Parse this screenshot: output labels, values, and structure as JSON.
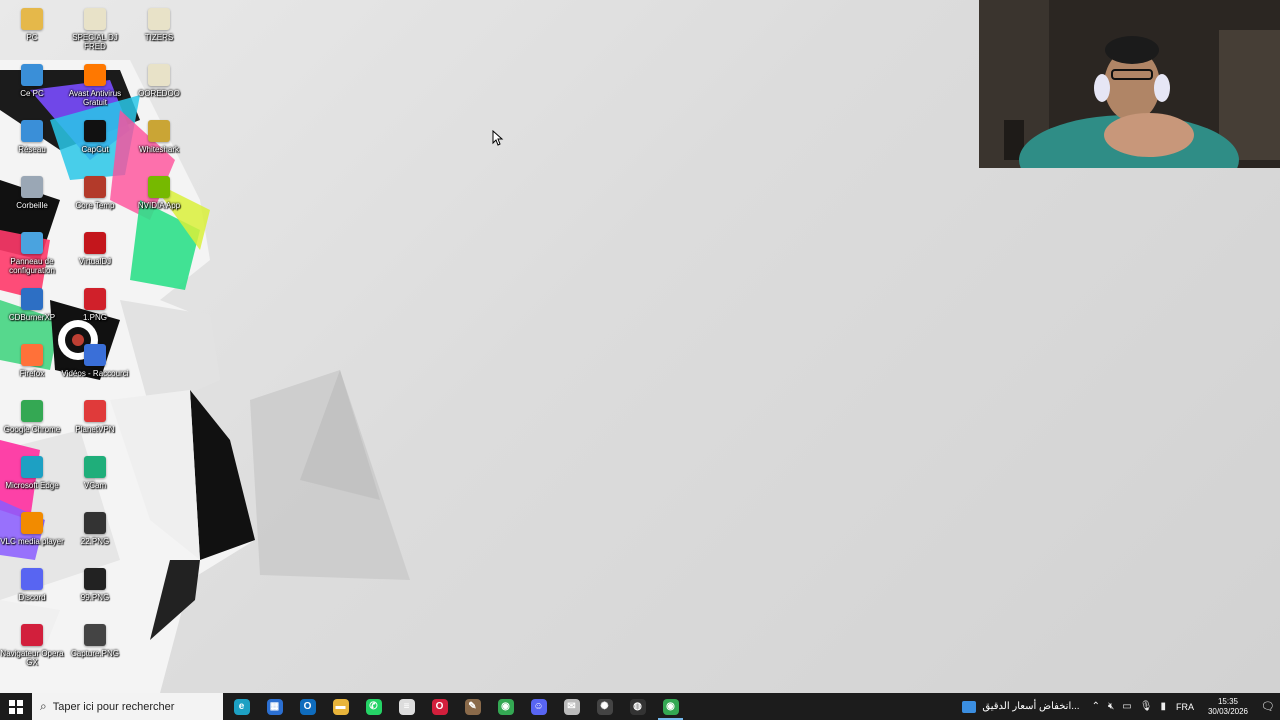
{
  "desktop": {
    "column1": [
      {
        "label": "PC",
        "icon": "user-folder-icon",
        "color": "#e5b84a"
      },
      {
        "label": "Ce PC",
        "icon": "computer-icon",
        "color": "#3a8fd8"
      },
      {
        "label": "Réseau",
        "icon": "network-icon",
        "color": "#3a8fd8"
      },
      {
        "label": "Corbeille",
        "icon": "recycle-bin-icon",
        "color": "#9aa7b5"
      },
      {
        "label": "Panneau de configuration",
        "icon": "control-panel-icon",
        "color": "#4aa3df"
      },
      {
        "label": "CDBurnerXP",
        "icon": "cdburnerxp-icon",
        "color": "#2d6fc4"
      },
      {
        "label": "Firefox",
        "icon": "firefox-icon",
        "color": "#ff7139"
      },
      {
        "label": "Google Chrome",
        "icon": "chrome-icon",
        "color": "#34a853"
      },
      {
        "label": "Microsoft Edge",
        "icon": "edge-icon",
        "color": "#1da0c3"
      },
      {
        "label": "VLC media player",
        "icon": "vlc-icon",
        "color": "#f28b00"
      },
      {
        "label": "Discord",
        "icon": "discord-icon",
        "color": "#5865f2"
      },
      {
        "label": "Navigateur Opera GX",
        "icon": "opera-gx-icon",
        "color": "#d21f3c"
      }
    ],
    "column2": [
      {
        "label": "SPECIAL DJ FRED",
        "icon": "folder-icon",
        "color": "#e8e2c8"
      },
      {
        "label": "Avast Antivirus Gratuit",
        "icon": "avast-icon",
        "color": "#ff7800"
      },
      {
        "label": "CapCut",
        "icon": "capcut-icon",
        "color": "#111111"
      },
      {
        "label": "Core Temp",
        "icon": "core-temp-icon",
        "color": "#b33a2a"
      },
      {
        "label": "VirtualDJ",
        "icon": "virtualdj-icon",
        "color": "#c4161c"
      },
      {
        "label": "1.PNG",
        "icon": "image-file-icon",
        "color": "#d0202a"
      },
      {
        "label": "Vidéos - Raccourci",
        "icon": "videos-shortcut-icon",
        "color": "#3a6fd8"
      },
      {
        "label": "PlanetVPN",
        "icon": "planetvpn-icon",
        "color": "#e03a3a"
      },
      {
        "label": "VCam",
        "icon": "vcam-icon",
        "color": "#1fae7a"
      },
      {
        "label": "22.PNG",
        "icon": "image-file-icon",
        "color": "#333333"
      },
      {
        "label": "99.PNG",
        "icon": "image-file-icon",
        "color": "#222222"
      },
      {
        "label": "Capture.PNG",
        "icon": "image-file-icon",
        "color": "#444444"
      }
    ],
    "column3": [
      {
        "label": "TIZERS",
        "icon": "folder-icon",
        "color": "#e8e2c8"
      },
      {
        "label": "OOREDOO",
        "icon": "folder-icon",
        "color": "#e8e2c8"
      },
      {
        "label": "Whiteshark",
        "icon": "folder-icon",
        "color": "#caa535"
      },
      {
        "label": "NVIDIA App",
        "icon": "nvidia-icon",
        "color": "#76b900"
      }
    ]
  },
  "taskbar": {
    "search_placeholder": "Taper ici pour rechercher",
    "apps": [
      {
        "name": "edge-taskbar-icon",
        "color": "#1da0c3",
        "glyph": "e"
      },
      {
        "name": "store-taskbar-icon",
        "color": "#2b6fd1",
        "glyph": "▦"
      },
      {
        "name": "outlook-taskbar-icon",
        "color": "#0f6cbd",
        "glyph": "O"
      },
      {
        "name": "file-explorer-taskbar-icon",
        "color": "#e8b43a",
        "glyph": "▬"
      },
      {
        "name": "whatsapp-taskbar-icon",
        "color": "#25d366",
        "glyph": "✆"
      },
      {
        "name": "notepad-taskbar-icon",
        "color": "#dddddd",
        "glyph": "≡"
      },
      {
        "name": "opera-taskbar-icon",
        "color": "#d21f3c",
        "glyph": "O"
      },
      {
        "name": "paint-taskbar-icon",
        "color": "#8a6a4a",
        "glyph": "✎"
      },
      {
        "name": "chrome-taskbar-icon",
        "color": "#34a853",
        "glyph": "◉"
      },
      {
        "name": "discord-taskbar-icon",
        "color": "#5865f2",
        "glyph": "☺"
      },
      {
        "name": "mail-taskbar-icon",
        "color": "#bbbbbb",
        "glyph": "✉"
      },
      {
        "name": "chatgpt-taskbar-icon",
        "color": "#444444",
        "glyph": "✺"
      },
      {
        "name": "obs-taskbar-icon",
        "color": "#333333",
        "glyph": "◍"
      },
      {
        "name": "chrome-active-taskbar-icon",
        "color": "#34a853",
        "glyph": "◉"
      }
    ],
    "news_text": "انخفاض أسعار الدقيق...",
    "language": "FRA",
    "time": "15:35",
    "date": "30/03/2026"
  }
}
